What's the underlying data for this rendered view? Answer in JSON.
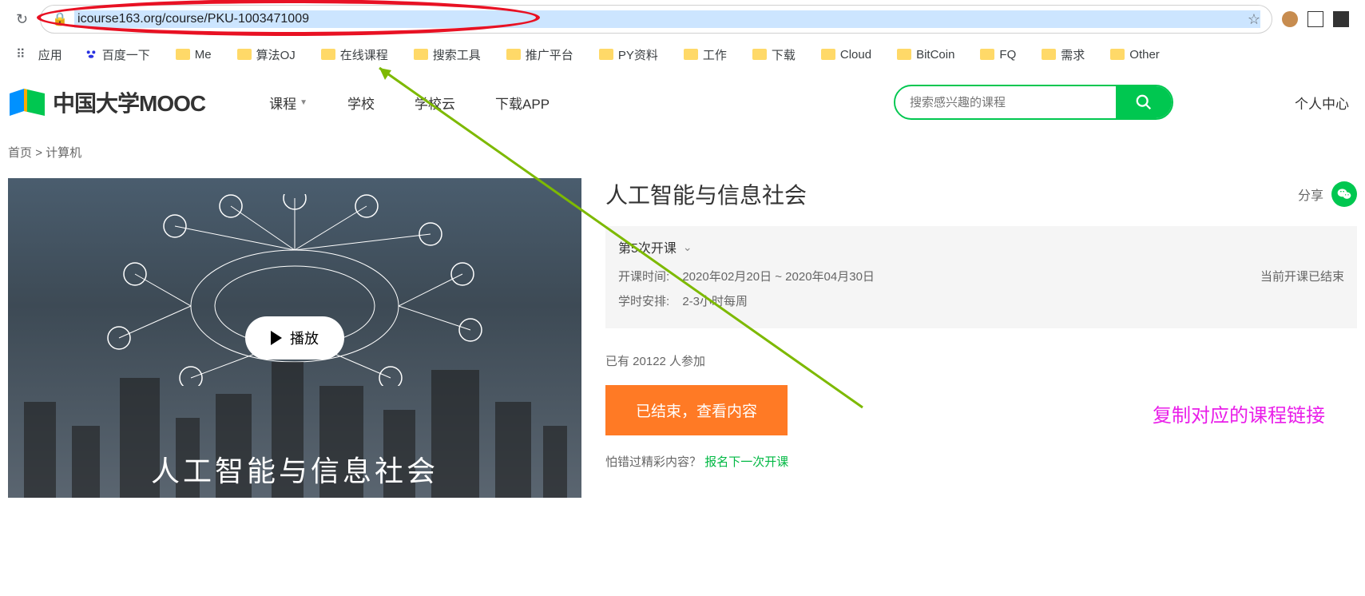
{
  "browser": {
    "url": "icourse163.org/course/PKU-1003471009",
    "bookmarks": {
      "apps": "应用",
      "baidu": "百度一下",
      "items": [
        "Me",
        "算法OJ",
        "在线课程",
        "搜索工具",
        "推广平台",
        "PY资料",
        "工作",
        "下载",
        "Cloud",
        "BitCoin",
        "FQ",
        "需求",
        "Other"
      ]
    }
  },
  "header": {
    "site_name": "中国大学MOOC",
    "nav": {
      "courses": "课程",
      "schools": "学校",
      "cloud": "学校云",
      "app": "下载APP"
    },
    "search_placeholder": "搜索感兴趣的课程",
    "personal": "个人中心"
  },
  "breadcrumb": {
    "home": "首页",
    "category": "计算机"
  },
  "course": {
    "title": "人工智能与信息社会",
    "share_label": "分享",
    "video_title": "人工智能与信息社会",
    "play_label": "播放",
    "session_label": "第5次开课",
    "open_time_label": "开课时间:",
    "open_time_value": "2020年02月20日 ~ 2020年04月30日",
    "status": "当前开课已结束",
    "hours_label": "学时安排:",
    "hours_value": "2-3小时每周",
    "participants_prefix": "已有 ",
    "participants_count": "20122",
    "participants_suffix": " 人参加",
    "cta": "已结束，查看内容",
    "follow_prefix": "怕错过精彩内容？",
    "follow_link": "报名下一次开课"
  },
  "annotation": {
    "text": "复制对应的课程链接"
  }
}
